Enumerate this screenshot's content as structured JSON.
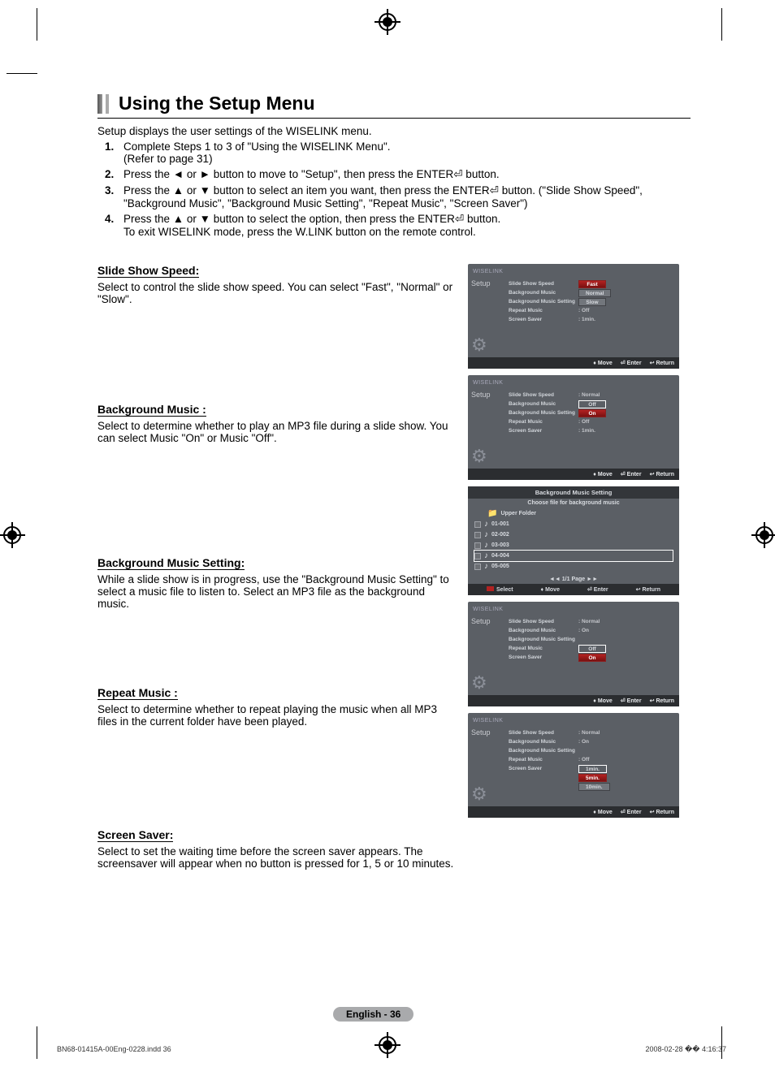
{
  "title": "Using the Setup Menu",
  "intro": "Setup displays the user settings of the WISELINK menu.",
  "steps": [
    {
      "line1": "Complete Steps 1 to 3 of \"Using the WISELINK Menu\".",
      "line2": "(Refer to page 31)"
    },
    {
      "line1": "Press the ◄ or ► button to move to \"Setup\", then press the ENTER⏎ button."
    },
    {
      "line1": "Press the ▲ or ▼ button to select an item you want, then press the ENTER⏎ button. (\"Slide Show Speed\",  \"Background Music\", \"Background Music Setting\", \"Repeat Music\", \"Screen Saver\")"
    },
    {
      "line1": "Press the ▲ or ▼ button to select the option, then press the ENTER⏎ button.",
      "line2": "To exit WISELINK mode, press the W.LINK button on the remote control."
    }
  ],
  "sections": [
    {
      "title": "Slide Show Speed:",
      "body": "Select to control the slide show speed. You can select \"Fast\", \"Normal\" or \"Slow\"."
    },
    {
      "title": "Background Music :",
      "body": "Select to determine whether to play an MP3 file during a slide show. You can select Music \"On\" or Music \"Off\"."
    },
    {
      "title": "Background Music Setting:",
      "body": "While a slide show is in progress, use the \"Background Music Setting\" to select a music file to listen to. Select an MP3 file as the background music."
    },
    {
      "title": "Repeat Music :",
      "body": "Select to determine whether to repeat playing the music when all MP3 files in the current folder have been played."
    },
    {
      "title": "Screen Saver:",
      "body": "Select to set the waiting time before the screen saver appears. The screensaver will appear when no button is pressed for 1, 5 or 10 minutes."
    }
  ],
  "tv_common": {
    "brand": "WISELINK",
    "setup": "Setup",
    "labels": {
      "sss": "Slide Show Speed",
      "bgm": "Background Music",
      "bgms": "Background Music Setting",
      "rm": "Repeat Music",
      "ss": "Screen Saver"
    },
    "foot": {
      "move": "Move",
      "enter": "Enter",
      "return": "Return",
      "select": "Select"
    }
  },
  "tv1": {
    "opts": [
      "Fast",
      "Normal",
      "Slow"
    ],
    "rm": ": Off",
    "ss": ": 1min."
  },
  "tv2": {
    "sss": ": Normal",
    "opts": [
      "Off",
      "On"
    ],
    "rm": ": Off",
    "ss": ": 1min."
  },
  "tv_bgm": {
    "title": "Background Music Setting",
    "sub": "Choose file for background music",
    "upper": "Upper Folder",
    "items": [
      "01-001",
      "02-002",
      "03-003",
      "04-004",
      "05-005"
    ],
    "page": "◄◄ 1/1 Page ►►"
  },
  "tv4": {
    "sss": ": Normal",
    "bgm": ": On",
    "opts": [
      "Off",
      "On"
    ]
  },
  "tv5": {
    "sss": ": Normal",
    "bgm": ": On",
    "rm": ": Off",
    "opts": [
      "1min.",
      "5min.",
      "10min."
    ]
  },
  "page_badge": "English - 36",
  "footer": {
    "left": "BN68-01415A-00Eng-0228.indd   36",
    "right": "2008-02-28   �� 4:16:37"
  }
}
